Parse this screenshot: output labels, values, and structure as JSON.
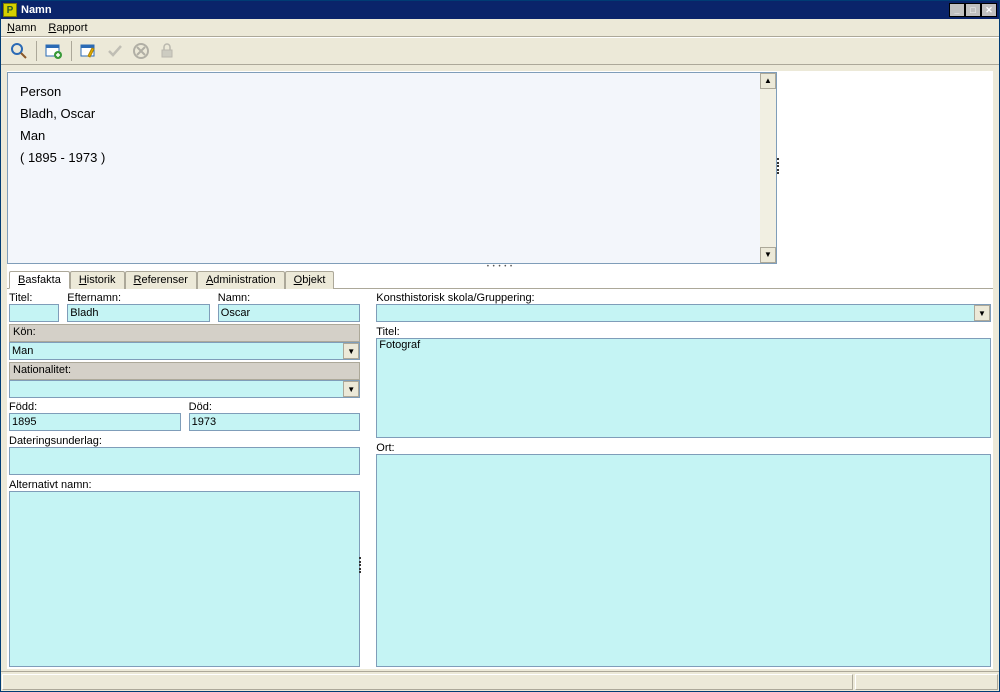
{
  "window": {
    "title": "Namn",
    "app_icon_letter": "P"
  },
  "menu": {
    "namn": "Namn",
    "rapport": "Rapport"
  },
  "summary": {
    "type": "Person",
    "name": "Bladh, Oscar",
    "gender": "Man",
    "dates": "( 1895 - 1973 )"
  },
  "tabs": [
    {
      "label": "Basfakta",
      "key": "B"
    },
    {
      "label": "Historik",
      "key": "H"
    },
    {
      "label": "Referenser",
      "key": "R"
    },
    {
      "label": "Administration",
      "key": "A"
    },
    {
      "label": "Objekt",
      "key": "O"
    }
  ],
  "labels": {
    "titel": "Titel:",
    "efternamn": "Efternamn:",
    "namn": "Namn:",
    "kon": "Kön:",
    "nationalitet": "Nationalitet:",
    "fodd": "Född:",
    "dod": "Död:",
    "dateringsunderlag": "Dateringsunderlag:",
    "alternativt": "Alternativt namn:",
    "konsthist": "Konsthistorisk skola/Gruppering:",
    "titel2": "Titel:",
    "ort": "Ort:"
  },
  "values": {
    "titel": "",
    "efternamn": "Bladh",
    "namn": "Oscar",
    "kon": "Man",
    "nationalitet": "",
    "fodd": "1895",
    "dod": "1973",
    "dateringsunderlag": "",
    "alternativt": "",
    "konsthist": "",
    "titel2": "Fotograf",
    "ort": ""
  }
}
